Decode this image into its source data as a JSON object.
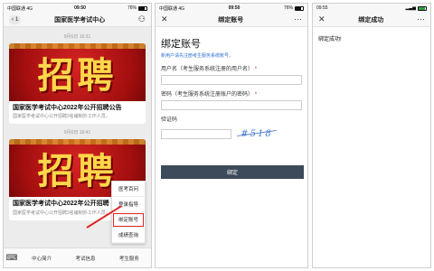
{
  "phone1": {
    "status": {
      "carrier": "中国联通 4G",
      "time": "09:50",
      "battery": "76%"
    },
    "nav": {
      "back_count": "1",
      "title": "国家医学考试中心"
    },
    "feed": [
      {
        "timestamp": "9月6日 16:31",
        "banner": "招聘",
        "title": "国家医学考试中心2022年公开招聘公告",
        "subtitle": "国家医学考试中心公开招聘3名编制外工作人员。"
      },
      {
        "timestamp": "9月6日 16:41",
        "banner": "招聘",
        "title": "国家医学考试中心2022年公开招聘",
        "subtitle": "国家医学考试中心公开招聘3名编制外工作人员。"
      }
    ],
    "popup": [
      "医考百问",
      "登录指导",
      "绑定账号",
      "成绩查询"
    ],
    "tabs": [
      "中心简介",
      "考试信息",
      "考生服务"
    ]
  },
  "phone2": {
    "status": {
      "carrier": "中国联通 4G",
      "time": "09:50",
      "battery": "76%"
    },
    "nav": {
      "title": "绑定账号"
    },
    "heading": "绑定账号",
    "hint": "新用户请先注册考生服务系统账号。",
    "username_label": "用户名（考生服务系统注册的用户名）",
    "password_label": "密码（考生服务系统注册账户的密码）",
    "captcha_label": "验证码",
    "captcha_code": "#518",
    "submit": "绑定"
  },
  "phone3": {
    "status": {
      "time": "09:55"
    },
    "nav": {
      "title": "绑定成功"
    },
    "message": "绑定成功!"
  },
  "colors": {
    "accent": "#3d4a5b",
    "highlight": "#e02424",
    "link": "#2f6fd1"
  }
}
